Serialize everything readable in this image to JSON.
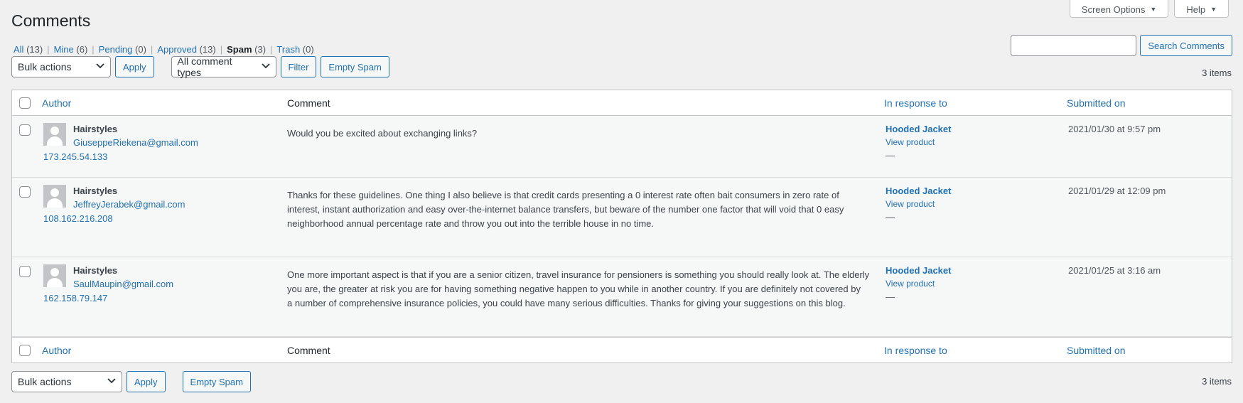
{
  "header": {
    "title": "Comments",
    "screen_options_label": "Screen Options",
    "help_label": "Help"
  },
  "filters": [
    {
      "label": "All",
      "count": "(13)",
      "current": false
    },
    {
      "label": "Mine",
      "count": "(6)",
      "current": false
    },
    {
      "label": "Pending",
      "count": "(0)",
      "current": false
    },
    {
      "label": "Approved",
      "count": "(13)",
      "current": false
    },
    {
      "label": "Spam",
      "count": "(3)",
      "current": true
    },
    {
      "label": "Trash",
      "count": "(0)",
      "current": false
    }
  ],
  "search": {
    "value": "",
    "button_label": "Search Comments"
  },
  "tablenav_top": {
    "bulk_actions_value": "Bulk actions",
    "apply_label": "Apply",
    "comment_type_value": "All comment types",
    "filter_label": "Filter",
    "empty_spam_label": "Empty Spam",
    "items_count": "3 items"
  },
  "tablenav_bottom": {
    "bulk_actions_value": "Bulk actions",
    "apply_label": "Apply",
    "empty_spam_label": "Empty Spam",
    "items_count": "3 items"
  },
  "columns": {
    "author": "Author",
    "comment": "Comment",
    "response": "In response to",
    "date": "Submitted on"
  },
  "comments": [
    {
      "author": "Hairstyles",
      "email": "GiuseppeRiekena@gmail.com",
      "ip": "173.245.54.133",
      "lines": [
        "Would you be excited about exchanging links?"
      ],
      "response_title": "Hooded Jacket",
      "view_label": "View product",
      "dash": "—",
      "date": "2021/01/30 at 9:57 pm"
    },
    {
      "author": "Hairstyles",
      "email": "JeffreyJerabek@gmail.com",
      "ip": "108.162.216.208",
      "lines": [
        "Thanks for these guidelines. One thing I also believe is that credit cards presenting a 0 interest rate often bait consumers in zero rate of",
        "interest, instant authorization and easy over-the-internet balance transfers, but beware of the number one factor that will void that 0 easy",
        "neighborhood annual percentage rate and throw you out into the terrible house in no time."
      ],
      "response_title": "Hooded Jacket",
      "view_label": "View product",
      "dash": "—",
      "date": "2021/01/29 at 12:09 pm"
    },
    {
      "author": "Hairstyles",
      "email": "SaulMaupin@gmail.com",
      "ip": "162.158.79.147",
      "lines": [
        "One more important aspect is that if you are a senior citizen, travel insurance for pensioners is something you should really look at. The elderly",
        "you are, the greater at risk you are for having something negative happen to you while in another country. If you are definitely not covered by",
        "a number of comprehensive insurance policies, you could have many serious difficulties. Thanks for giving your suggestions on this blog."
      ],
      "response_title": "Hooded Jacket",
      "view_label": "View product",
      "dash": "—",
      "date": "2021/01/25 at 3:16 am"
    }
  ]
}
